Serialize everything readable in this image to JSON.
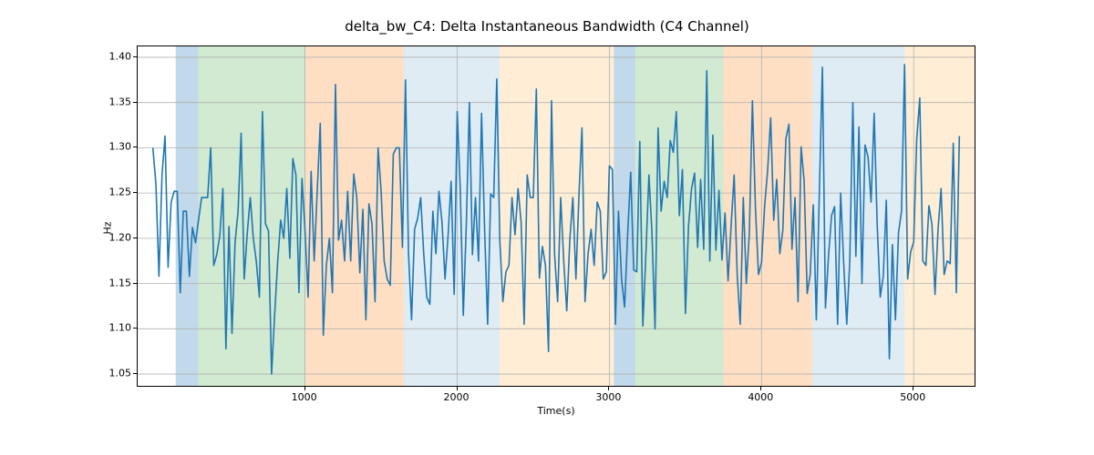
{
  "chart_data": {
    "type": "line",
    "title": "delta_bw_C4: Delta Instantaneous Bandwidth (C4 Channel)",
    "xlabel": "Time(s)",
    "ylabel": "Hz",
    "xlim": [
      -100,
      5400
    ],
    "ylim": [
      1.037,
      1.412
    ],
    "xticks": [
      1000,
      2000,
      3000,
      4000,
      5000
    ],
    "yticks": [
      1.05,
      1.1,
      1.15,
      1.2,
      1.25,
      1.3,
      1.35,
      1.4
    ],
    "ytick_labels": [
      "1.05",
      "1.10",
      "1.15",
      "1.20",
      "1.25",
      "1.30",
      "1.35",
      "1.40"
    ],
    "grid": true,
    "line_color": "#1f77b4",
    "background_bands": [
      {
        "x0": 150,
        "x1": 300,
        "color": "rgba(31,119,180,0.28)"
      },
      {
        "x0": 300,
        "x1": 1000,
        "color": "rgba(44,160,44,0.22)"
      },
      {
        "x0": 1000,
        "x1": 1650,
        "color": "rgba(255,127,14,0.25)"
      },
      {
        "x0": 1650,
        "x1": 2280,
        "color": "rgba(31,119,180,0.14)"
      },
      {
        "x0": 2280,
        "x1": 3030,
        "color": "rgba(255,224,178,0.55)"
      },
      {
        "x0": 3030,
        "x1": 3170,
        "color": "rgba(31,119,180,0.28)"
      },
      {
        "x0": 3170,
        "x1": 3750,
        "color": "rgba(44,160,44,0.22)"
      },
      {
        "x0": 3750,
        "x1": 4330,
        "color": "rgba(255,127,14,0.25)"
      },
      {
        "x0": 4330,
        "x1": 4940,
        "color": "rgba(31,119,180,0.14)"
      },
      {
        "x0": 4940,
        "x1": 5400,
        "color": "rgba(255,224,178,0.55)"
      }
    ],
    "x": [
      0,
      20,
      40,
      60,
      80,
      100,
      120,
      140,
      160,
      180,
      200,
      220,
      240,
      260,
      280,
      300,
      320,
      340,
      360,
      380,
      400,
      420,
      440,
      460,
      480,
      500,
      520,
      540,
      560,
      580,
      600,
      620,
      640,
      660,
      680,
      700,
      720,
      740,
      760,
      780,
      800,
      820,
      840,
      860,
      880,
      900,
      920,
      940,
      960,
      980,
      1000,
      1020,
      1040,
      1060,
      1080,
      1100,
      1120,
      1140,
      1160,
      1180,
      1200,
      1220,
      1240,
      1260,
      1280,
      1300,
      1320,
      1340,
      1360,
      1380,
      1400,
      1420,
      1440,
      1460,
      1480,
      1500,
      1520,
      1540,
      1560,
      1580,
      1600,
      1620,
      1640,
      1660,
      1680,
      1700,
      1720,
      1740,
      1760,
      1780,
      1800,
      1820,
      1840,
      1860,
      1880,
      1900,
      1920,
      1940,
      1960,
      1980,
      2000,
      2020,
      2040,
      2060,
      2080,
      2100,
      2120,
      2140,
      2160,
      2180,
      2200,
      2220,
      2240,
      2260,
      2280,
      2300,
      2320,
      2340,
      2360,
      2380,
      2400,
      2420,
      2440,
      2460,
      2480,
      2500,
      2520,
      2540,
      2560,
      2580,
      2600,
      2620,
      2640,
      2660,
      2680,
      2700,
      2720,
      2740,
      2760,
      2780,
      2800,
      2820,
      2840,
      2860,
      2880,
      2900,
      2920,
      2940,
      2960,
      2980,
      3000,
      3020,
      3040,
      3060,
      3080,
      3100,
      3120,
      3140,
      3160,
      3180,
      3200,
      3220,
      3240,
      3260,
      3280,
      3300,
      3320,
      3340,
      3360,
      3380,
      3400,
      3420,
      3440,
      3460,
      3480,
      3500,
      3520,
      3540,
      3560,
      3580,
      3600,
      3620,
      3640,
      3660,
      3680,
      3700,
      3720,
      3740,
      3760,
      3780,
      3800,
      3820,
      3840,
      3860,
      3880,
      3900,
      3920,
      3940,
      3960,
      3980,
      4000,
      4020,
      4040,
      4060,
      4080,
      4100,
      4120,
      4140,
      4160,
      4180,
      4200,
      4220,
      4240,
      4260,
      4280,
      4300,
      4320,
      4340,
      4360,
      4380,
      4400,
      4420,
      4440,
      4460,
      4480,
      4500,
      4520,
      4540,
      4560,
      4580,
      4600,
      4620,
      4640,
      4660,
      4680,
      4700,
      4720,
      4740,
      4760,
      4780,
      4800,
      4820,
      4840,
      4860,
      4880,
      4900,
      4920,
      4940,
      4960,
      4980,
      5000,
      5020,
      5040,
      5060,
      5080,
      5100,
      5120,
      5140,
      5160,
      5180,
      5200,
      5220,
      5240,
      5260,
      5280,
      5300
    ],
    "values": [
      1.3,
      1.26,
      1.158,
      1.27,
      1.313,
      1.168,
      1.24,
      1.252,
      1.252,
      1.14,
      1.23,
      1.23,
      1.158,
      1.212,
      1.195,
      1.22,
      1.245,
      1.245,
      1.245,
      1.3,
      1.17,
      1.182,
      1.203,
      1.255,
      1.078,
      1.213,
      1.095,
      1.195,
      1.23,
      1.316,
      1.155,
      1.205,
      1.245,
      1.2,
      1.174,
      1.135,
      1.34,
      1.216,
      1.208,
      1.05,
      1.115,
      1.174,
      1.22,
      1.2,
      1.255,
      1.178,
      1.288,
      1.27,
      1.14,
      1.266,
      1.208,
      1.135,
      1.274,
      1.175,
      1.252,
      1.327,
      1.093,
      1.17,
      1.2,
      1.14,
      1.37,
      1.198,
      1.22,
      1.175,
      1.252,
      1.175,
      1.271,
      1.245,
      1.162,
      1.232,
      1.11,
      1.238,
      1.216,
      1.13,
      1.3,
      1.252,
      1.175,
      1.155,
      1.148,
      1.293,
      1.3,
      1.3,
      1.19,
      1.375,
      1.183,
      1.11,
      1.21,
      1.222,
      1.245,
      1.183,
      1.135,
      1.127,
      1.23,
      1.183,
      1.252,
      1.218,
      1.155,
      1.203,
      1.263,
      1.138,
      1.34,
      1.255,
      1.115,
      1.216,
      1.35,
      1.182,
      1.245,
      1.175,
      1.338,
      1.21,
      1.105,
      1.249,
      1.245,
      1.376,
      1.198,
      1.13,
      1.163,
      1.17,
      1.245,
      1.204,
      1.255,
      1.218,
      1.105,
      1.27,
      1.245,
      1.245,
      1.365,
      1.156,
      1.191,
      1.17,
      1.075,
      1.352,
      1.182,
      1.13,
      1.245,
      1.175,
      1.12,
      1.198,
      1.245,
      1.155,
      1.247,
      1.322,
      1.13,
      1.183,
      1.21,
      1.17,
      1.24,
      1.23,
      1.155,
      1.163,
      1.28,
      1.276,
      1.105,
      1.23,
      1.155,
      1.124,
      1.204,
      1.273,
      1.165,
      1.163,
      1.307,
      1.103,
      1.183,
      1.27,
      1.206,
      1.1,
      1.322,
      1.23,
      1.263,
      1.245,
      1.308,
      1.295,
      1.34,
      1.225,
      1.276,
      1.117,
      1.213,
      1.255,
      1.272,
      1.19,
      1.265,
      1.188,
      1.385,
      1.175,
      1.314,
      1.187,
      1.253,
      1.176,
      1.228,
      1.153,
      1.214,
      1.27,
      1.16,
      1.105,
      1.245,
      1.15,
      1.206,
      1.352,
      1.233,
      1.16,
      1.173,
      1.235,
      1.275,
      1.333,
      1.22,
      1.265,
      1.183,
      1.209,
      1.31,
      1.326,
      1.188,
      1.245,
      1.13,
      1.301,
      1.263,
      1.139,
      1.16,
      1.237,
      1.11,
      1.251,
      1.389,
      1.123,
      1.18,
      1.225,
      1.235,
      1.105,
      1.25,
      1.172,
      1.105,
      1.175,
      1.35,
      1.18,
      1.323,
      1.15,
      1.303,
      1.29,
      1.24,
      1.338,
      1.215,
      1.135,
      1.158,
      1.242,
      1.067,
      1.193,
      1.11,
      1.206,
      1.23,
      1.392,
      1.155,
      1.185,
      1.196,
      1.31,
      1.355,
      1.175,
      1.17,
      1.236,
      1.215,
      1.138,
      1.21,
      1.255,
      1.16,
      1.175,
      1.172,
      1.305,
      1.14,
      1.313
    ]
  }
}
